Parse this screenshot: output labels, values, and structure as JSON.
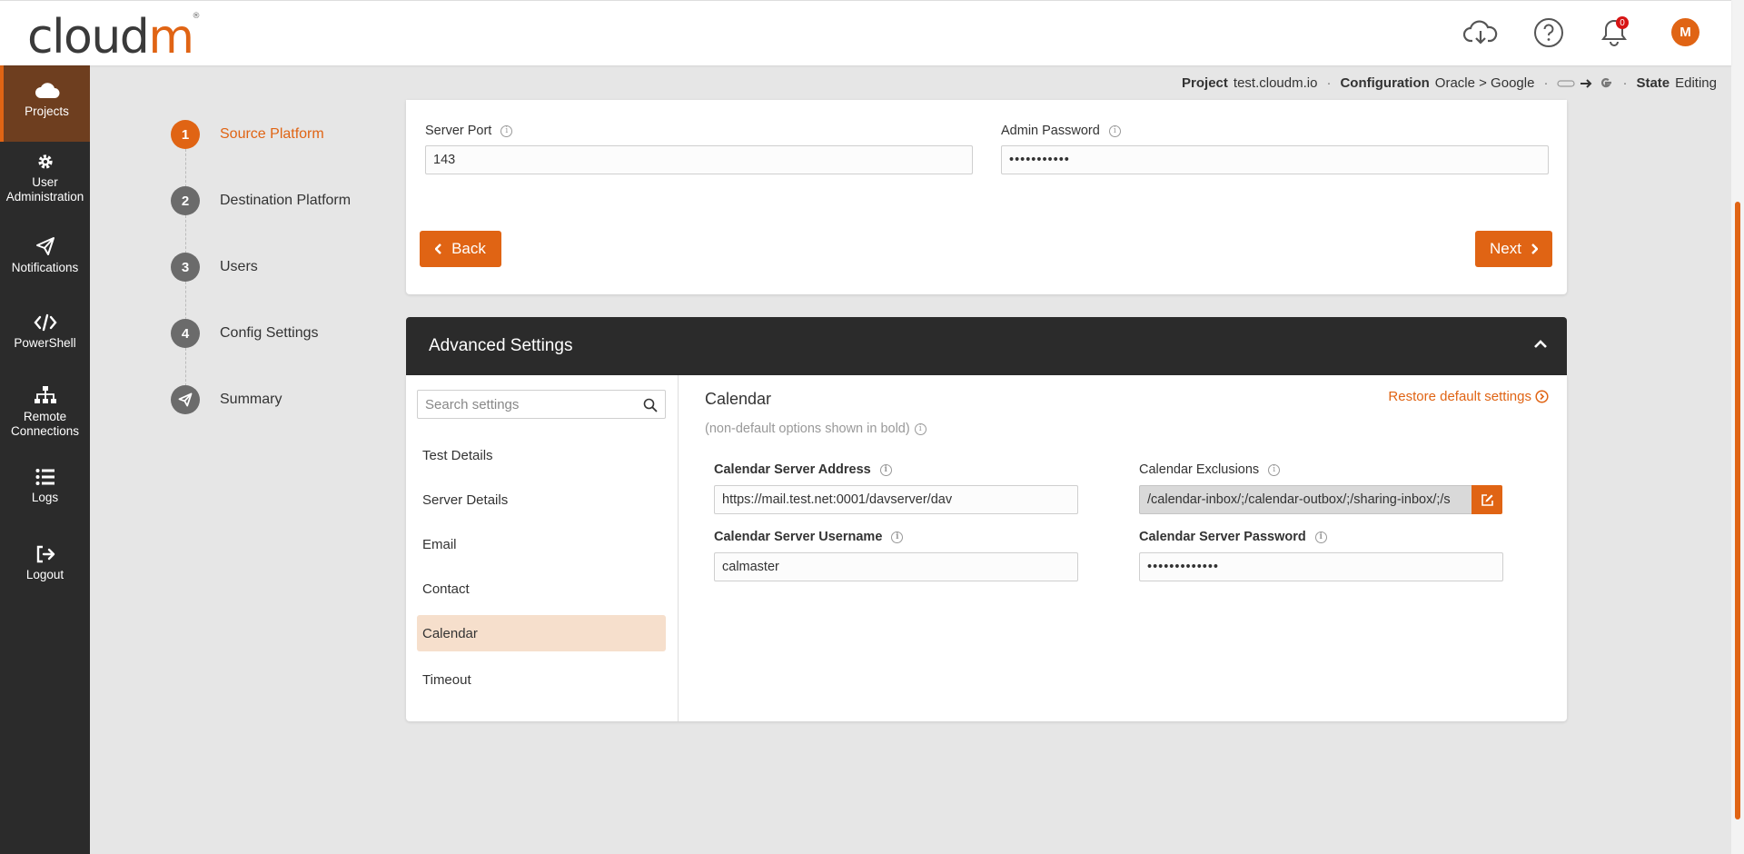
{
  "brand": {
    "logo_main": "cloud",
    "logo_accent": "m",
    "logo_reg": "®"
  },
  "topbar": {
    "notification_count": "0",
    "avatar_initial": "M"
  },
  "sidebar": {
    "items": [
      {
        "label": "Projects"
      },
      {
        "label": "User Administration"
      },
      {
        "label": "Notifications"
      },
      {
        "label": "PowerShell"
      },
      {
        "label": "Remote Connections"
      },
      {
        "label": "Logs"
      },
      {
        "label": "Logout"
      }
    ]
  },
  "status": {
    "project_label": "Project",
    "project_value": "test.cloudm.io",
    "config_label": "Configuration",
    "config_value": "Oracle > Google",
    "state_label": "State",
    "state_value": "Editing"
  },
  "steps": [
    {
      "num": "1",
      "label": "Source Platform"
    },
    {
      "num": "2",
      "label": "Destination Platform"
    },
    {
      "num": "3",
      "label": "Users"
    },
    {
      "num": "4",
      "label": "Config Settings"
    },
    {
      "label": "Summary"
    }
  ],
  "server_form": {
    "port_label": "Server Port",
    "port_value": "143",
    "admin_pw_label": "Admin Password",
    "admin_pw_value": "•••••••••••",
    "back_label": "Back",
    "next_label": "Next"
  },
  "advanced": {
    "title": "Advanced Settings",
    "search_placeholder": "Search settings",
    "menu": [
      "Test Details",
      "Server Details",
      "Email",
      "Contact",
      "Calendar",
      "Timeout"
    ],
    "section_title": "Calendar",
    "restore_label": "Restore default settings",
    "note": "(non-default options shown in bold)",
    "fields": {
      "server_address_label": "Calendar Server Address",
      "server_address_value": "https://mail.test.net:0001/davserver/dav",
      "exclusions_label": "Calendar Exclusions",
      "exclusions_value": "/calendar-inbox/;/calendar-outbox/;/sharing-inbox/;/s",
      "username_label": "Calendar Server Username",
      "username_value": "calmaster",
      "password_label": "Calendar Server Password",
      "password_value": "•••••••••••••"
    }
  },
  "colors": {
    "accent": "#e06414",
    "sidebar": "#2b2b2b",
    "selected": "#f6dfcc"
  }
}
